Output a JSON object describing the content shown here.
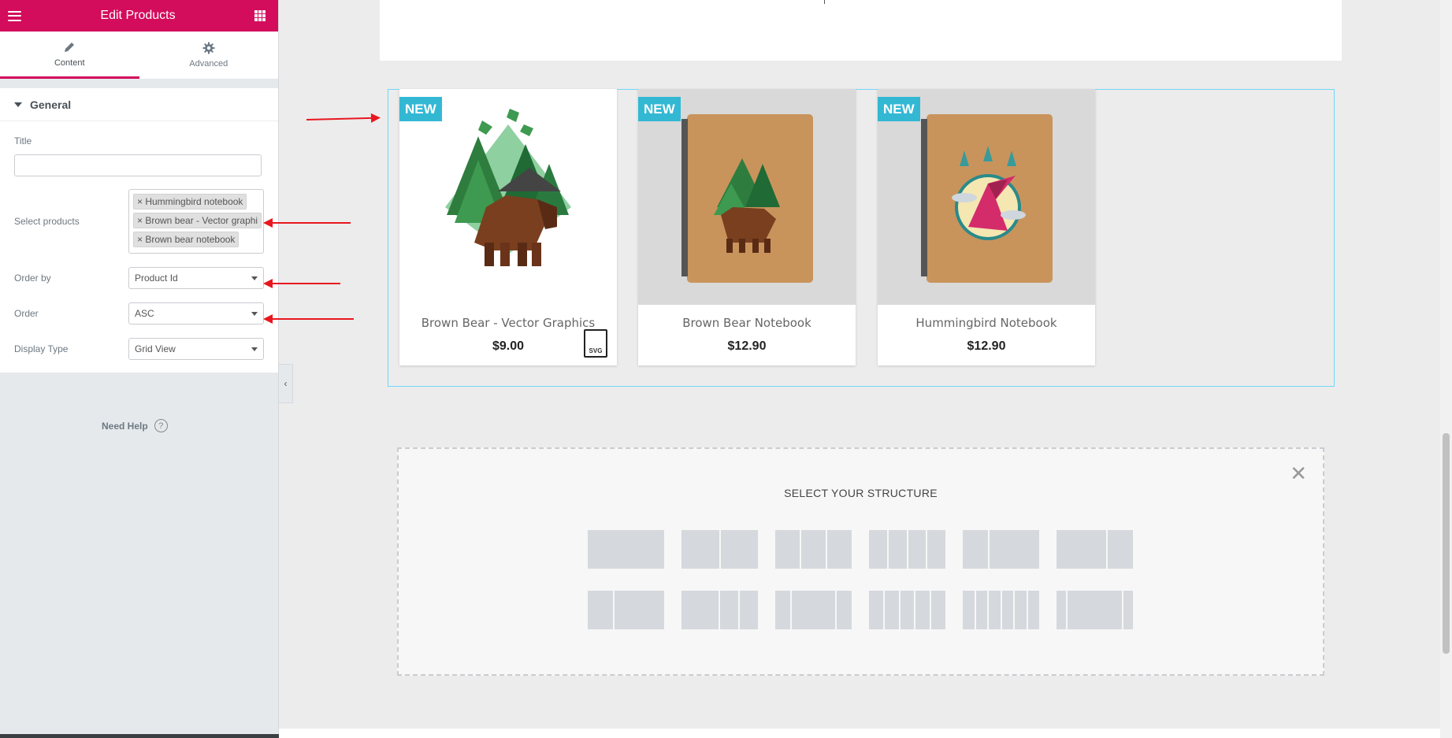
{
  "panel": {
    "title": "Edit Products",
    "tabs": [
      {
        "label": "Content",
        "icon": "pencil-icon"
      },
      {
        "label": "Advanced",
        "icon": "gear-icon"
      }
    ],
    "section": "General",
    "fields": {
      "title_label": "Title",
      "title_value": "",
      "select_products_label": "Select products",
      "selected_products": [
        "Hummingbird notebook",
        "Brown bear - Vector graphi",
        "Brown bear notebook"
      ],
      "order_by_label": "Order by",
      "order_by_value": "Product Id",
      "order_label": "Order",
      "order_value": "ASC",
      "display_type_label": "Display Type",
      "display_type_value": "Grid View"
    },
    "need_help": "Need Help",
    "help_icon_glyph": "?"
  },
  "products": [
    {
      "badge": "NEW",
      "name": "Brown Bear - Vector Graphics",
      "price": "$9.00",
      "file_badge": "SVG"
    },
    {
      "badge": "NEW",
      "name": "Brown Bear Notebook",
      "price": "$12.90"
    },
    {
      "badge": "NEW",
      "name": "Hummingbird Notebook",
      "price": "$12.90"
    }
  ],
  "structure": {
    "title": "SELECT YOUR STRUCTURE",
    "close_glyph": "✕"
  },
  "colors": {
    "brand": "#d30c5c",
    "badge": "#33b8d4",
    "annotation": "#e8171f",
    "frame": "#71d7f7"
  }
}
